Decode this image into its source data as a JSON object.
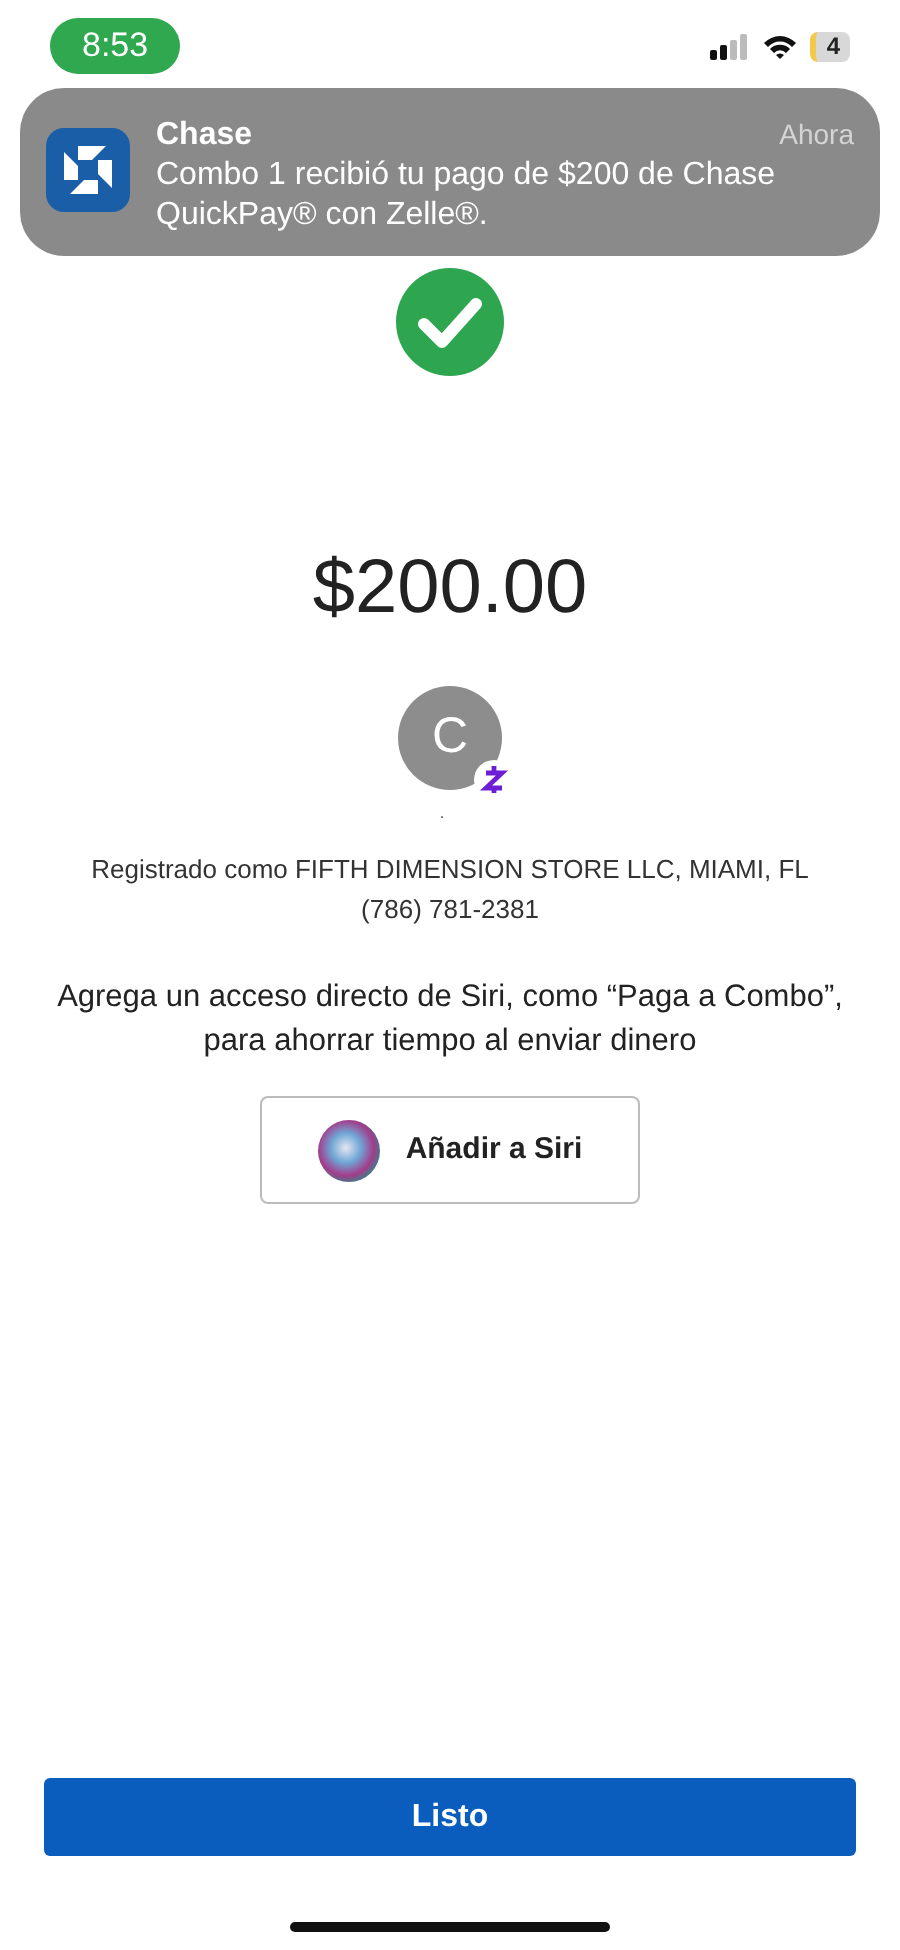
{
  "status_bar": {
    "time": "8:53",
    "battery": "4"
  },
  "notification": {
    "app": "Chase",
    "time": "Ahora",
    "message": "Combo 1 recibió tu pago de $200 de Chase QuickPay® con Zelle®."
  },
  "amount": "$200.00",
  "recipient": {
    "initial": "C",
    "name": "."
  },
  "registered": [
    "Registrado como FIFTH DIMENSION STORE LLC, MIAMI, FL",
    "(786) 781-2381"
  ],
  "siri_hint": "Agrega un acceso directo de Siri, como “Paga a Combo”, para ahorrar tiempo al enviar dinero",
  "siri_button": "Añadir a Siri",
  "done_button": "Listo"
}
